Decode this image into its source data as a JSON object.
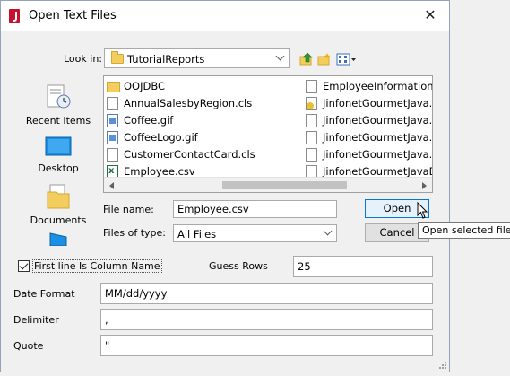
{
  "window": {
    "title": "Open Text Files",
    "close_glyph": "✕"
  },
  "look_in": {
    "label": "Look in:",
    "value": "TutorialReports"
  },
  "places": [
    {
      "label": "Recent Items",
      "icon": "recent-items-icon"
    },
    {
      "label": "Desktop",
      "icon": "desktop-icon"
    },
    {
      "label": "Documents",
      "icon": "documents-icon"
    },
    {
      "label": "",
      "icon": "computer-icon"
    }
  ],
  "files": {
    "column1": [
      {
        "name": "OOJDBC",
        "icon": "folder-icon"
      },
      {
        "name": "AnnualSalesbyRegion.cls",
        "icon": "document-icon"
      },
      {
        "name": "Coffee.gif",
        "icon": "image-icon"
      },
      {
        "name": "CoffeeLogo.gif",
        "icon": "image-icon"
      },
      {
        "name": "CustomerContactCard.cls",
        "icon": "document-icon"
      },
      {
        "name": "Employee.csv",
        "icon": "excel-icon"
      }
    ],
    "column2": [
      {
        "name": "EmployeeInformation.c",
        "icon": "document-icon"
      },
      {
        "name": "JinfonetGourmetJava.ca",
        "icon": "java-icon"
      },
      {
        "name": "JinfonetGourmetJava.ca",
        "icon": "document-icon"
      },
      {
        "name": "JinfonetGourmetJava.ca",
        "icon": "document-icon"
      },
      {
        "name": "JinfonetGourmetJava.p",
        "icon": "document-icon"
      },
      {
        "name": "JinfonetGourmetJavaDa",
        "icon": "document-icon"
      }
    ]
  },
  "file_name": {
    "label": "File name:",
    "value": "Employee.csv"
  },
  "file_type": {
    "label": "Files of type:",
    "value": "All Files"
  },
  "buttons": {
    "open": "Open",
    "cancel": "Cancel"
  },
  "tooltip": "Open selected file",
  "options": {
    "first_line_label": "First line Is Column Name",
    "first_line_checked": true,
    "guess_rows_label": "Guess Rows",
    "guess_rows_value": "25",
    "date_format_label": "Date Format",
    "date_format_value": "MM/dd/yyyy",
    "delimiter_label": "Delimiter",
    "delimiter_value": ",",
    "quote_label": "Quote",
    "quote_value": "\""
  },
  "colors": {
    "accent": "#0078d7",
    "folder": "#f3cd5d",
    "app_icon": "#c8102e"
  }
}
